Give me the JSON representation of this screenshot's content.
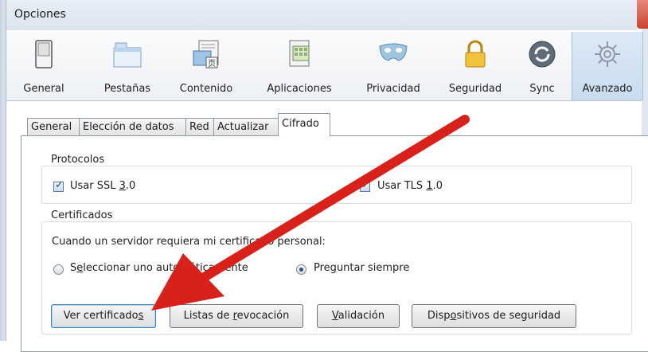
{
  "window": {
    "title": "Opciones"
  },
  "toolbar": {
    "items": [
      {
        "label": "General",
        "icon": "switch-icon"
      },
      {
        "label": "Pestañas",
        "icon": "tabs-icon"
      },
      {
        "label": "Contenido",
        "icon": "content-icon"
      },
      {
        "label": "Aplicaciones",
        "icon": "applications-icon"
      },
      {
        "label": "Privacidad",
        "icon": "mask-icon"
      },
      {
        "label": "Seguridad",
        "icon": "padlock-icon"
      },
      {
        "label": "Sync",
        "icon": "sync-icon"
      },
      {
        "label": "Avanzado",
        "icon": "gear-icon"
      }
    ],
    "active": "Avanzado"
  },
  "subtabs": [
    "General",
    "Elección de datos",
    "Red",
    "Actualizar",
    "Cifrado"
  ],
  "selected_subtab": "Cifrado",
  "protocolos": {
    "legend": "Protocolos",
    "ssl": {
      "label_pre": "Usar SSL ",
      "label_u": "3",
      "label_post": ".0",
      "checked": true
    },
    "tls": {
      "label_pre": "Usar TLS ",
      "label_u": "1",
      "label_post": ".0",
      "checked": true
    }
  },
  "certificados": {
    "legend": "Certificados",
    "prompt": "Cuando un servidor requiera mi certificado personal:",
    "radio_auto": {
      "pre": "S",
      "u": "e",
      "post": "leccionar uno automáticamente",
      "selected": false
    },
    "radio_ask": {
      "pre": "Pre",
      "u": "g",
      "post": "untar siempre",
      "selected": true
    }
  },
  "buttons": {
    "ver": {
      "pre": "Ver certificado",
      "u": "s",
      "post": ""
    },
    "listas": {
      "pre": "Listas de ",
      "u": "r",
      "post": "evocación"
    },
    "validacion": {
      "pre": "",
      "u": "V",
      "post": "alidación"
    },
    "dispositivos": {
      "pre": "Disp",
      "u": "o",
      "post": "sitivos de seguridad"
    }
  },
  "colors": {
    "arrow": "#d8211b",
    "accent": "#3c7fb1"
  }
}
